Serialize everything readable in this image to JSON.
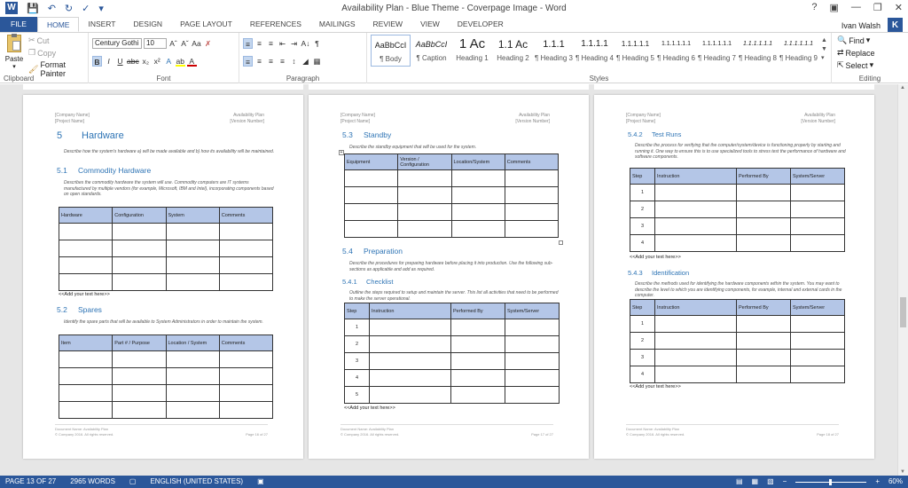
{
  "titlebar": {
    "title": "Availability Plan - Blue Theme - Coverpage Image - Word",
    "user_name": "Ivan Walsh",
    "user_initial": "K"
  },
  "tabs": [
    "FILE",
    "HOME",
    "INSERT",
    "DESIGN",
    "PAGE LAYOUT",
    "REFERENCES",
    "MAILINGS",
    "REVIEW",
    "VIEW",
    "DEVELOPER"
  ],
  "ribbon": {
    "clipboard": {
      "paste": "Paste",
      "cut": "Cut",
      "copy": "Copy",
      "format_painter": "Format Painter",
      "label": "Clipboard"
    },
    "font": {
      "name": "Century Gothi",
      "size": "10",
      "label": "Font"
    },
    "paragraph": {
      "label": "Paragraph"
    },
    "styles": {
      "label": "Styles",
      "items": [
        {
          "preview": "AaBbCcI",
          "name": "¶ Body"
        },
        {
          "preview": "AaBbCcI",
          "name": "¶ Caption"
        },
        {
          "preview": "1  Ac",
          "name": "Heading 1"
        },
        {
          "preview": "1.1  Ac",
          "name": "Heading 2"
        },
        {
          "preview": "1.1.1",
          "name": "¶ Heading 3"
        },
        {
          "preview": "1.1.1.1",
          "name": "¶ Heading 4"
        },
        {
          "preview": "1.1.1.1.1",
          "name": "¶ Heading 5"
        },
        {
          "preview": "1.1.1.1.1.1",
          "name": "¶ Heading 6"
        },
        {
          "preview": "1.1.1.1.1.1",
          "name": "¶ Heading 7"
        },
        {
          "preview": "1.1.1.1.1.1",
          "name": "¶ Heading 8"
        },
        {
          "preview": "1.1.1.1.1.1",
          "name": "¶ Heading 9"
        }
      ]
    },
    "editing": {
      "find": "Find",
      "replace": "Replace",
      "select": "Select",
      "label": "Editing"
    }
  },
  "document": {
    "header_left_1": "[Company Name]",
    "header_left_2": "[Project Name]",
    "header_right_1": "Availability Plan",
    "header_right_2": "[Version Number]",
    "footer_left_1": "Document Name: Availability Plan",
    "footer_left_2": "© Company 2016. All rights reserved.",
    "add_text": "<<Add your text here>>",
    "pages": [
      {
        "footer_page": "Page 16 of 27",
        "h1": {
          "num": "5",
          "text": "Hardware"
        },
        "h1_desc": "Describe how the system's hardware a) will be made available and b) how its availability will be maintained.",
        "sections": [
          {
            "num": "5.1",
            "title": "Commodity Hardware",
            "desc": "Describes the commodity hardware the system will use. Commodity computers are IT systems manufactured by multiple vendors (for example, Microsoft, IBM and Intel), incorporating components based on open standards.",
            "columns": [
              "Hardware",
              "Configuration",
              "System",
              "Comments"
            ]
          },
          {
            "num": "5.2",
            "title": "Spares",
            "desc": "Identify the spare parts that will be available to System Administrators in order to maintain the system.",
            "columns": [
              "Item",
              "Part # / Purpose",
              "Location / System",
              "Comments"
            ]
          }
        ]
      },
      {
        "footer_page": "Page 17 of 27",
        "sections": [
          {
            "num": "5.3",
            "title": "Standby",
            "desc": "Describe the standby equipment that will be used for the system.",
            "columns": [
              "Equipment",
              "Version / Configuration",
              "Location/System",
              "Comments"
            ]
          },
          {
            "num": "5.4",
            "title": "Preparation",
            "desc": "Describe the procedures for preparing hardware before placing it into production. Use the following sub-sections as applicable and add as required."
          },
          {
            "num": "5.4.1",
            "title": "Checklist",
            "desc": "Outline the steps required to setup and maintain the server. This list all activities that need to be performed to make the server operational.",
            "columns": [
              "Step",
              "Instruction",
              "Performed By",
              "System/Server"
            ],
            "steps": [
              "1",
              "2",
              "3",
              "4",
              "5"
            ]
          }
        ]
      },
      {
        "footer_page": "Page 18 of 27",
        "sections": [
          {
            "num": "5.4.2",
            "title": "Test Runs",
            "desc": "Describe the process for verifying that the computer/system/device is functioning properly by starting and running it. One way to ensure this is to use specialized tools to stress test the performance of hardware and software components.",
            "columns": [
              "Step",
              "Instruction",
              "Performed By",
              "System/Server"
            ],
            "steps": [
              "1",
              "2",
              "3",
              "4"
            ]
          },
          {
            "num": "5.4.3",
            "title": "Identification",
            "desc": "Describe the methods used for identifying the hardware components within the system. You may want to describe the level to which you are identifying components, for example, internal and external cards in the computer.",
            "columns": [
              "Step",
              "Instruction",
              "Performed By",
              "System/Server"
            ],
            "steps": [
              "1",
              "2",
              "3",
              "4"
            ]
          }
        ]
      }
    ]
  },
  "status": {
    "page": "PAGE 13 OF 27",
    "words": "2965 WORDS",
    "language": "ENGLISH (UNITED STATES)",
    "zoom": "60%"
  }
}
